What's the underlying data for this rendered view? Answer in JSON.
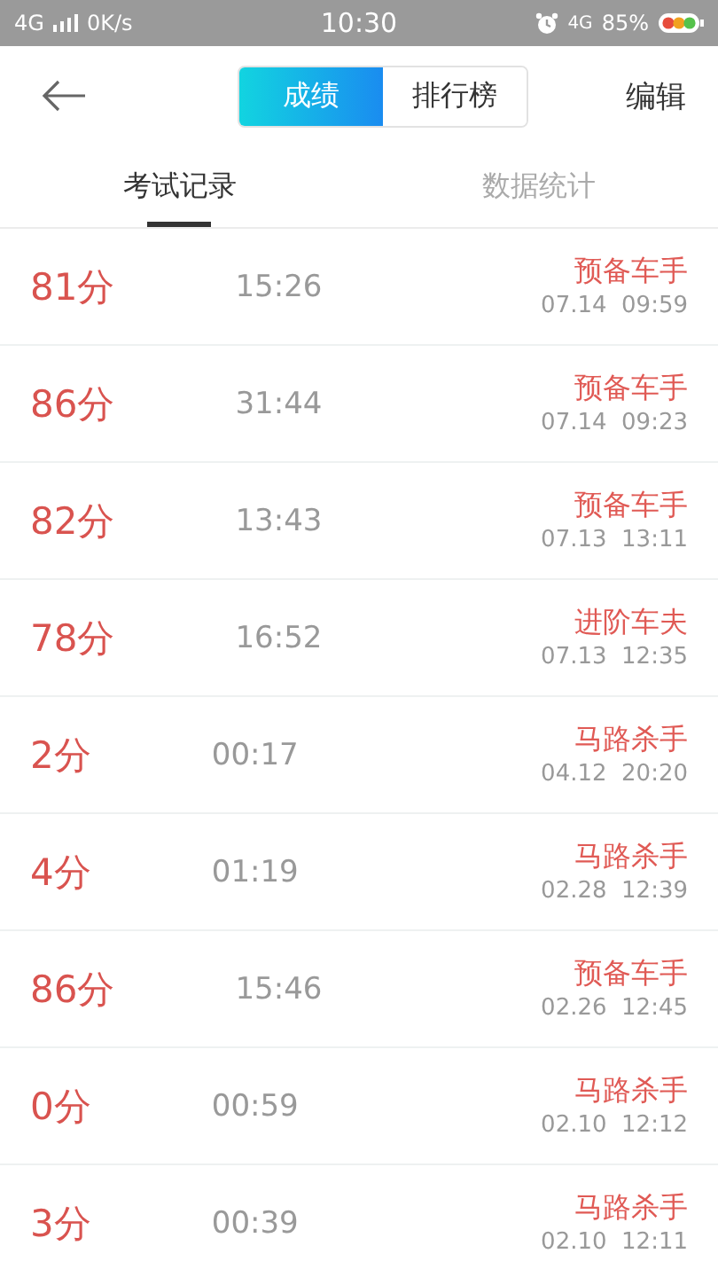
{
  "status_bar": {
    "network": "4G",
    "speed": "0K/s",
    "time": "10:30",
    "network_right": "4G",
    "battery": "85%"
  },
  "header": {
    "segments": [
      {
        "label": "成绩",
        "selected": true
      },
      {
        "label": "排行榜",
        "selected": false
      }
    ],
    "action": "编辑"
  },
  "tabs": [
    {
      "label": "考试记录",
      "selected": true
    },
    {
      "label": "数据统计",
      "selected": false
    }
  ],
  "records": [
    {
      "score": "81分",
      "duration": "15:26",
      "rank": "预备车手",
      "date": "07.14  09:59"
    },
    {
      "score": "86分",
      "duration": "31:44",
      "rank": "预备车手",
      "date": "07.14  09:23"
    },
    {
      "score": "82分",
      "duration": "13:43",
      "rank": "预备车手",
      "date": "07.13  13:11"
    },
    {
      "score": "78分",
      "duration": "16:52",
      "rank": "进阶车夫",
      "date": "07.13  12:35"
    },
    {
      "score": "2分",
      "duration": "00:17",
      "rank": "马路杀手",
      "date": "04.12  20:20"
    },
    {
      "score": "4分",
      "duration": "01:19",
      "rank": "马路杀手",
      "date": "02.28  12:39"
    },
    {
      "score": "86分",
      "duration": "15:46",
      "rank": "预备车手",
      "date": "02.26  12:45"
    },
    {
      "score": "0分",
      "duration": "00:59",
      "rank": "马路杀手",
      "date": "02.10  12:12"
    },
    {
      "score": "3分",
      "duration": "00:39",
      "rank": "马路杀手",
      "date": "02.10  12:11"
    }
  ]
}
